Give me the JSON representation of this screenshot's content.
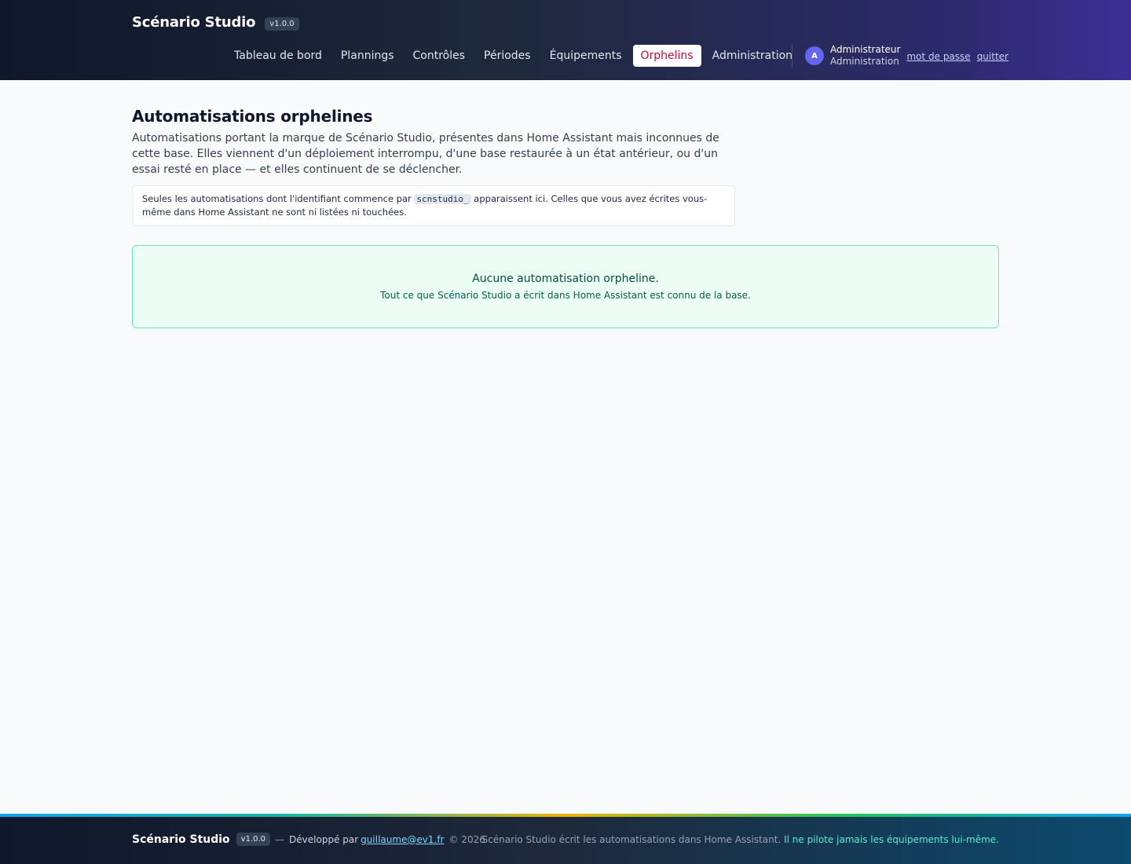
{
  "header": {
    "brand": "Scénario Studio",
    "version": "v1.0.0",
    "nav": [
      {
        "label": "Tableau de bord",
        "active": false
      },
      {
        "label": "Plannings",
        "active": false
      },
      {
        "label": "Contrôles",
        "active": false
      },
      {
        "label": "Périodes",
        "active": false
      },
      {
        "label": "Équipements",
        "active": false
      },
      {
        "label": "Orphelins",
        "active": true
      },
      {
        "label": "Administration",
        "active": false
      }
    ],
    "user": {
      "initial": "A",
      "name": "Administrateur",
      "role": "Administration",
      "password_link": "mot de passe",
      "logout_link": "quitter"
    },
    "colors": {
      "active_nav_text": "#be123c",
      "avatar": "#6366f1"
    }
  },
  "main": {
    "title": "Automatisations orphelines",
    "description": "Automatisations portant la marque de Scénario Studio, présentes dans Home Assistant mais inconnues de cette base. Elles viennent d'un déploiement interrompu, d'une base restaurée à un état antérieur, ou d'un essai resté en place — et elles continuent de se déclencher.",
    "note": {
      "before": "Seules les automatisations dont l'identifiant commence par ",
      "code": "scnstudio_",
      "after": " apparaissent ici. Celles que vous avez écrites vous-même dans Home Assistant ne sont ni listées ni touchées."
    },
    "empty_state": {
      "title": "Aucune automatisation orpheline.",
      "subtitle": "Tout ce que Scénario Studio a écrit dans Home Assistant est connu de la base."
    }
  },
  "footer": {
    "brand": "Scénario Studio",
    "version": "v1.0.0",
    "dash": "—",
    "developed_by": "Développé par",
    "email": "guillaume@ev1.fr",
    "copyright": "© 2026",
    "info": "Scénario Studio écrit les automatisations dans Home Assistant.",
    "accent": "Il ne pilote jamais les équipements lui-même."
  }
}
